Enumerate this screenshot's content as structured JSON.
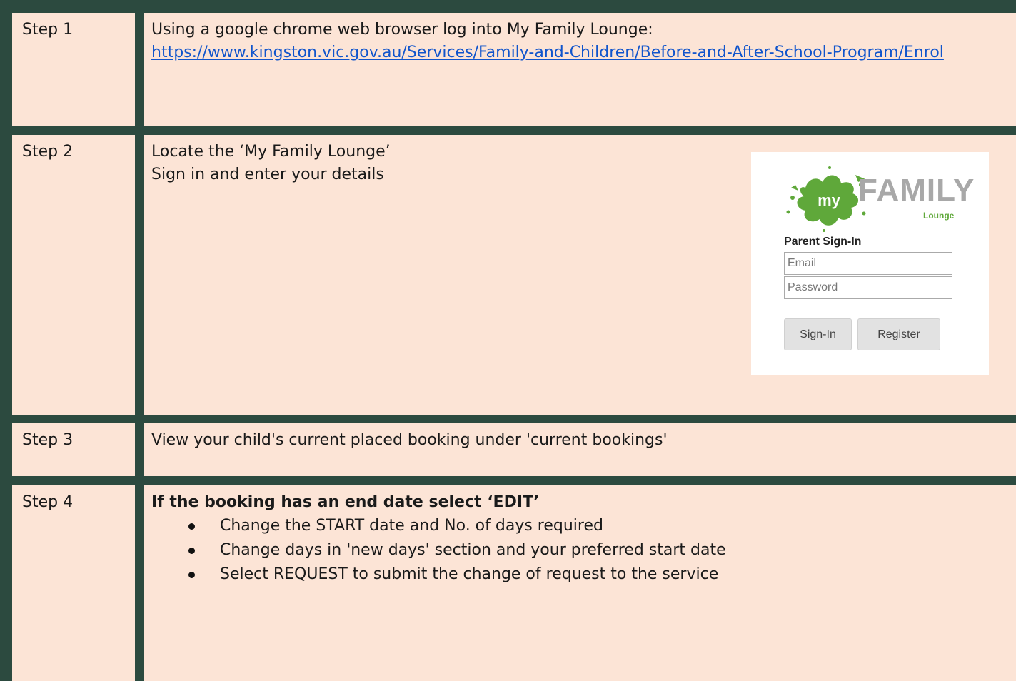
{
  "steps": [
    {
      "label": "Step 1",
      "text": "Using  a google chrome web browser log into  My Family Lounge:",
      "link": "https://www.kingston.vic.gov.au/Services/Family-and-Children/Before-and-After-School-Program/Enrol"
    },
    {
      "label": "Step 2",
      "lines": [
        "Locate the ‘My Family Lounge’",
        "Sign in and enter your details"
      ]
    },
    {
      "label": "Step 3",
      "text": "View your child's current placed booking under 'current bookings'"
    },
    {
      "label": "Step 4",
      "heading": "If the booking has an end date select ‘EDIT’",
      "bullets": [
        "Change the START date and No. of days required",
        "Change days in 'new days' section and your preferred start date",
        "Select  REQUEST to submit the change of request to the service"
      ]
    }
  ],
  "signin": {
    "logo_word": "my",
    "logo_text": "FAMILY",
    "logo_sub": "Lounge",
    "title": "Parent Sign-In",
    "email_placeholder": "Email",
    "password_placeholder": "Password",
    "signin_button": "Sign-In",
    "register_button": "Register"
  },
  "colors": {
    "frame": "#2c4a3f",
    "cell": "#fce4d6",
    "link": "#1155cc",
    "logo_green": "#5fa83a"
  }
}
